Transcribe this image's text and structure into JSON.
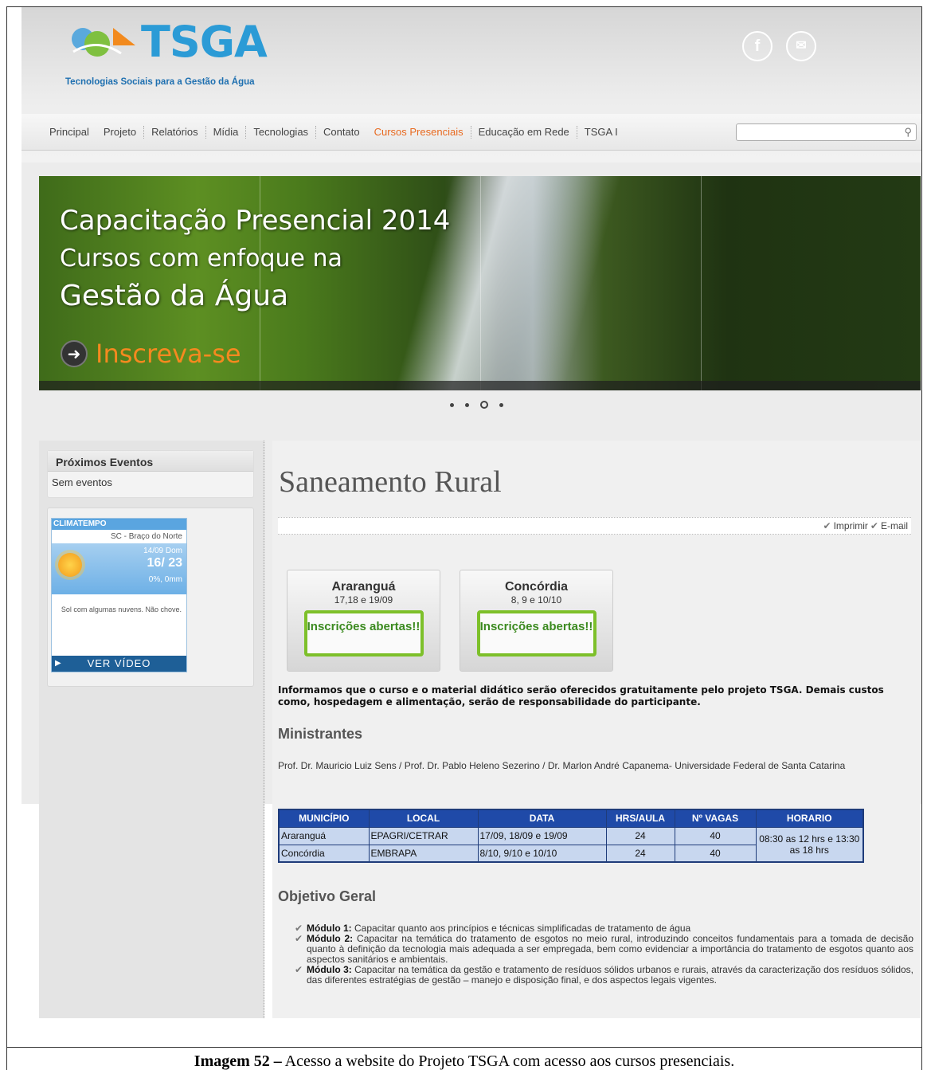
{
  "header": {
    "logo_text": "TSGA",
    "logo_subtitle": "Tecnologias Sociais para a Gestão da Água",
    "social": {
      "facebook": "f",
      "email": "✉"
    }
  },
  "nav": {
    "items": [
      "Principal",
      "Projeto",
      "Relatórios",
      "Mídia",
      "Tecnologias",
      "Contato",
      "Cursos Presenciais",
      "Educação em Rede",
      "TSGA I"
    ],
    "active": "Cursos Presenciais",
    "search_placeholder": ""
  },
  "banner": {
    "line1": "Capacitação Presencial 2014",
    "line2": "Cursos com enfoque na",
    "line3": "Gestão da Água",
    "cta": "Inscreva-se",
    "slide_count": 4,
    "active_slide": 3
  },
  "sidebar": {
    "events_title": "Próximos Eventos",
    "events_empty": "Sem eventos",
    "weather": {
      "brand": "CLIMATEMPO",
      "location": "SC - Braço do Norte",
      "date": "14/09 Dom",
      "temp": "16/  23",
      "rain": "0%, 0mm",
      "description": "Sol com algumas nuvens. Não chove.",
      "video_label": "VER VÍDEO"
    }
  },
  "main": {
    "title": "Saneamento Rural",
    "print_label": "Imprimir",
    "email_label": "E-mail",
    "courses": [
      {
        "city": "Araranguá",
        "dates": "17,18 e 19/09",
        "button": "Inscrições abertas!!"
      },
      {
        "city": "Concórdia",
        "dates": "8, 9 e 10/10",
        "button": "Inscrições abertas!!"
      }
    ],
    "info": "Informamos que o curso e o material didático serão oferecidos gratuitamente pelo projeto TSGA. Demais custos como, hospedagem e alimentação, serão de responsabilidade do participante.",
    "ministrantes_title": "Ministrantes",
    "ministrantes_text": "Prof. Dr. Mauricio Luiz Sens / Prof. Dr. Pablo Heleno Sezerino / Dr. Marlon André Capanema- Universidade Federal de Santa Catarina",
    "table": {
      "headers": [
        "MUNICÍPIO",
        "LOCAL",
        "DATA",
        "HRS/AULA",
        "Nº VAGAS",
        "HORARIO"
      ],
      "rows": [
        [
          "Araranguá",
          "EPAGRI/CETRAR",
          "17/09, 18/09 e 19/09",
          "24",
          "40"
        ],
        [
          "Concórdia",
          "EMBRAPA",
          "8/10, 9/10 e 10/10",
          "24",
          "40"
        ]
      ],
      "horario": "08:30 as 12 hrs e 13:30 as 18 hrs"
    },
    "objetivo_title": "Objetivo Geral",
    "objetivos": [
      {
        "label": "Módulo 1:",
        "text": " Capacitar quanto aos princípios e técnicas simplificadas de tratamento de água"
      },
      {
        "label": "Módulo 2:",
        "text": " Capacitar na temática do tratamento de esgotos no meio rural, introduzindo conceitos fundamentais para a tomada de decisão quanto à definição da tecnologia mais adequada a ser empregada, bem como evidenciar a importância do tratamento de esgotos quanto aos aspectos sanitários e ambientais."
      },
      {
        "label": "Módulo 3:",
        "text": " Capacitar na temática da gestão e tratamento de resíduos sólidos urbanos e rurais, através da caracterização dos resíduos sólidos, das diferentes estratégias de gestão – manejo e disposição final, e dos aspectos legais vigentes."
      }
    ]
  },
  "caption": {
    "label": "Imagem 52 –",
    "text": " Acesso a website do Projeto TSGA com acesso aos cursos presenciais."
  },
  "colors": {
    "accent_orange": "#e86a20",
    "brand_blue": "#2b9bd6",
    "green_button": "#7dc02a",
    "table_header": "#1f4aa8"
  }
}
